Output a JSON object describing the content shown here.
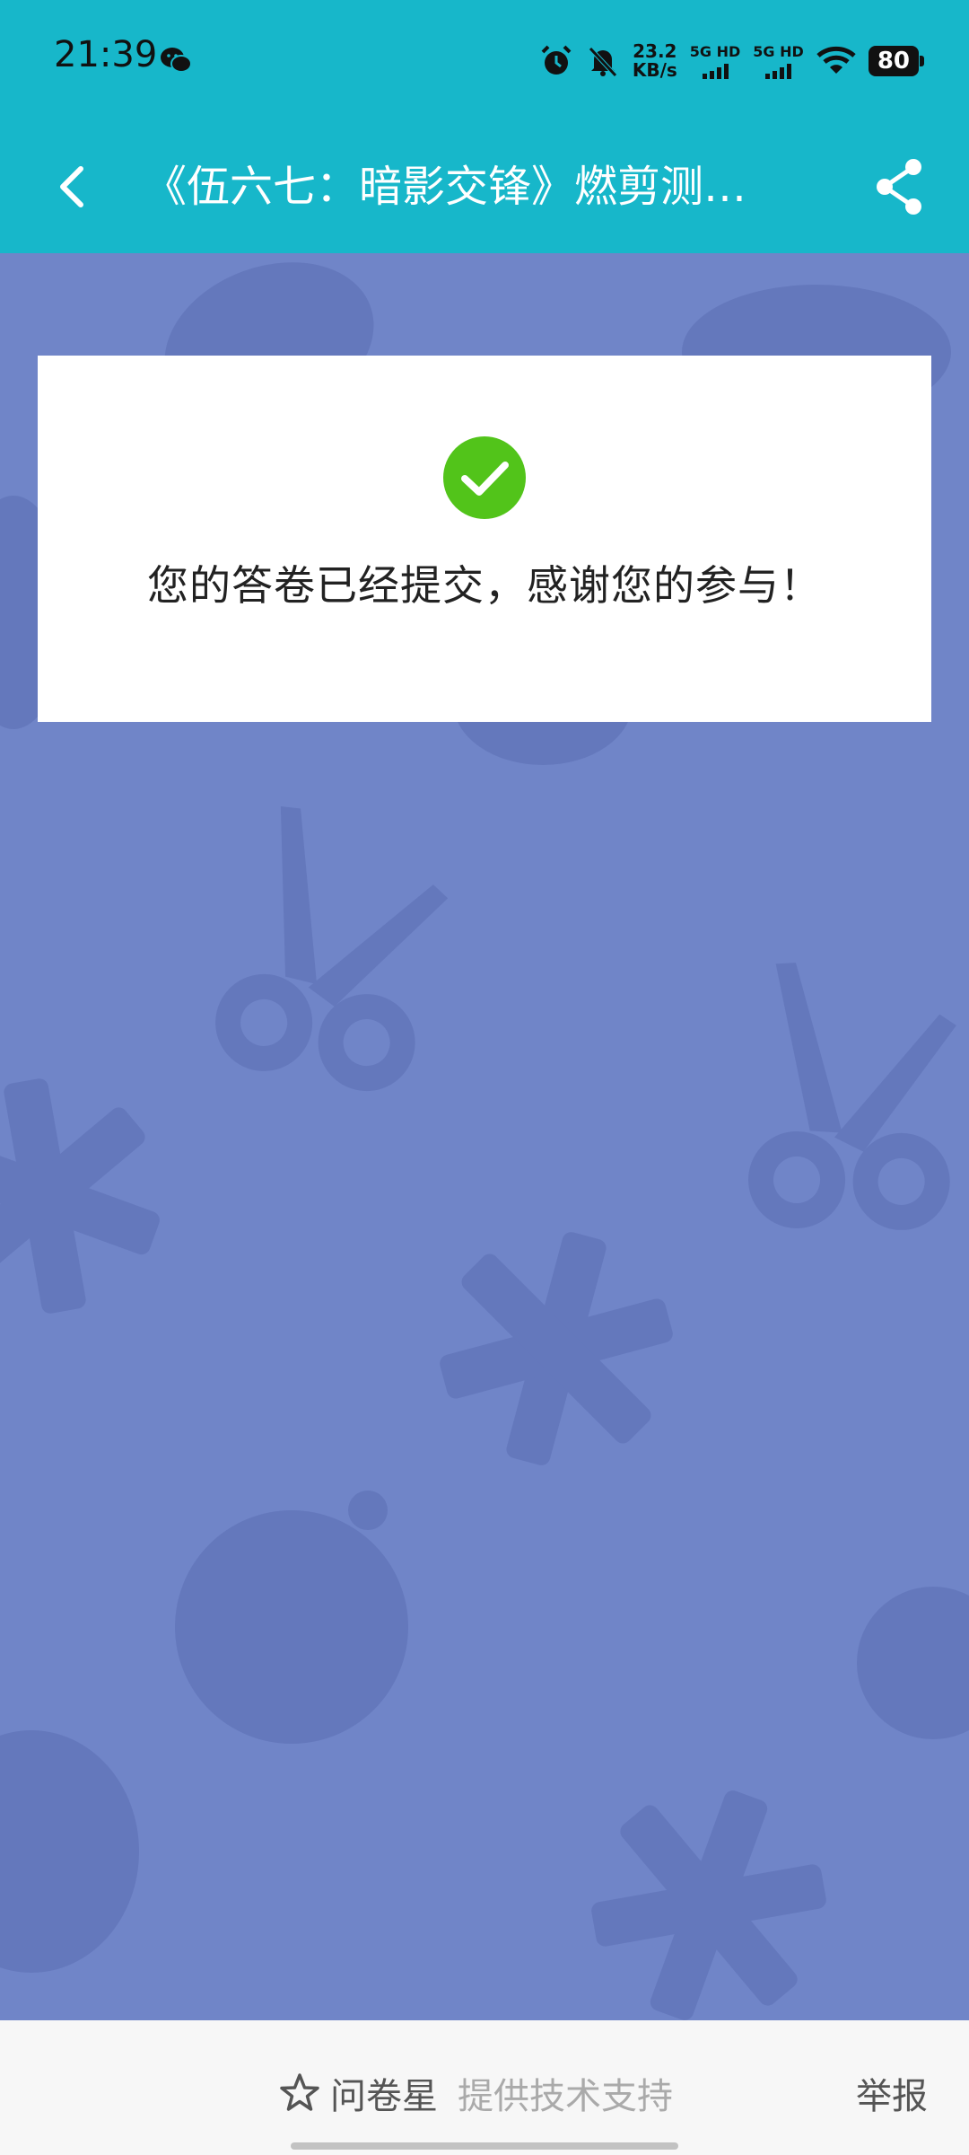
{
  "status_bar": {
    "time": "21:39",
    "net_speed_value": "23.2",
    "net_speed_unit": "KB/s",
    "sim1_label": "5G HD",
    "sim2_label": "5G HD",
    "battery": "80",
    "icons": [
      "wechat-icon",
      "alarm-icon",
      "mute-icon",
      "wifi-icon"
    ]
  },
  "app_bar": {
    "title": "《伍六七：暗影交锋》燃剪测…",
    "back_icon": "chevron-left-icon",
    "share_icon": "share-icon"
  },
  "result": {
    "icon": "check-circle-icon",
    "message": "您的答卷已经提交，感谢您的参与！",
    "accent_color": "#52c41a"
  },
  "footer": {
    "brand_icon": "star-icon",
    "brand_name": "问卷星",
    "brand_sub": "提供技术支持",
    "report": "举报"
  },
  "colors": {
    "header": "#17b7ca",
    "background": "#7085c8",
    "pattern": "#6478bc"
  }
}
